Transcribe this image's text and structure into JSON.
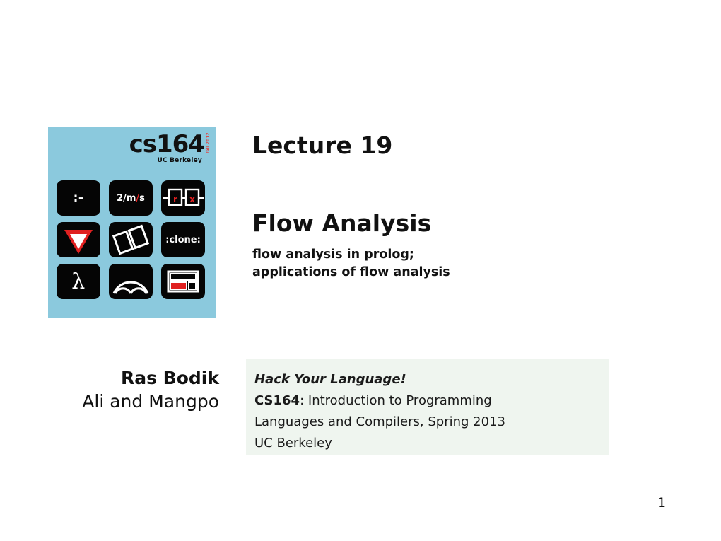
{
  "slide": {
    "number": "1",
    "background_color": "#ffffff"
  },
  "logo": {
    "background_color": "#8bc9dd",
    "wordmark": "cs164",
    "term_label": "fall 2012",
    "subtitle": "UC Berkeley",
    "tiles": [
      {
        "name": "prolog-neck",
        "text": ":-",
        "icon": "prolog-neck-icon"
      },
      {
        "name": "units",
        "text_parts": [
          {
            "t": "2/m",
            "red": false
          },
          {
            "t": "/",
            "red": true
          },
          {
            "t": "s",
            "red": false
          }
        ],
        "icon": "units-icon"
      },
      {
        "name": "regex-boxes",
        "icon": "regex-boxes-icon",
        "box_labels": [
          "r",
          "x"
        ]
      },
      {
        "name": "yield-triangle",
        "icon": "yield-triangle-icon"
      },
      {
        "name": "parallelogram-split",
        "icon": "parallelogram-split-icon"
      },
      {
        "name": "clone",
        "text": ":clone:",
        "icon": "clone-icon"
      },
      {
        "name": "lambda",
        "text": "λ",
        "icon": "lambda-icon"
      },
      {
        "name": "parse-arcs",
        "icon": "parse-arcs-icon"
      },
      {
        "name": "layout-grid",
        "icon": "layout-grid-icon"
      }
    ]
  },
  "title": {
    "lecture_number": "Lecture 19",
    "topic": "Flow Analysis",
    "subtopics": "flow analysis in prolog;\napplications of flow analysis",
    "subtopic_lines": [
      "flow analysis in prolog;",
      "applications of flow analysis"
    ]
  },
  "authors": {
    "primary": "Ras Bodik",
    "secondary": "Ali and Mangpo"
  },
  "course_info": {
    "background_color": "#eff5ef",
    "tagline": "Hack Your Language!",
    "code": "CS164",
    "description": ": Introduction to Programming",
    "description_line2": "Languages and Compilers, Spring 2013",
    "school": "UC Berkeley",
    "school_color": "#4a4ad0"
  }
}
